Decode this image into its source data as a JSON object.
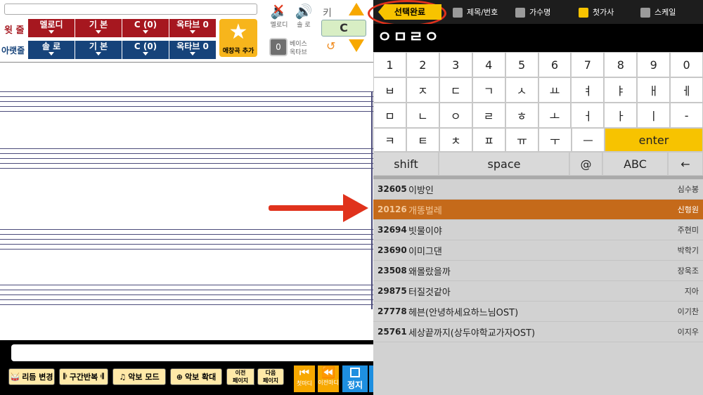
{
  "left": {
    "row1_label": "윗 줄",
    "row2_label": "아랫줄",
    "top_tabs": [
      "멜로디",
      "기 본",
      "C (0)",
      "옥타브 0"
    ],
    "bottom_tabs": [
      "솔 로",
      "기 본",
      "C (0)",
      "옥타브 0"
    ],
    "fav_label": "애창곡 추가",
    "mute_label": "멜로디",
    "solo_label": "솔 로",
    "key_label": "키",
    "key_value": "C",
    "bass_value": "0",
    "bass_label1": "베이스",
    "bass_label2": "옥타브"
  },
  "toolbar": {
    "rhythm": "리듬 변경",
    "section": "구간반복",
    "score_mode": "악보 모드",
    "zoom": "악보 확대",
    "prev_page": [
      "이전",
      "페이지"
    ],
    "next_page": [
      "다음",
      "페이지"
    ],
    "first": "첫마디",
    "prev": "이전마디",
    "stop": "정지"
  },
  "right": {
    "done_button": "선택완료",
    "filters": [
      {
        "label": "제목/번호",
        "checked": false
      },
      {
        "label": "가수명",
        "checked": false
      },
      {
        "label": "첫가사",
        "checked": true
      },
      {
        "label": "스케일",
        "checked": false
      }
    ],
    "search_text": "ㅇㅁㄹㅇ",
    "keyboard": {
      "row1": [
        "1",
        "2",
        "3",
        "4",
        "5",
        "6",
        "7",
        "8",
        "9",
        "0"
      ],
      "row2": [
        "ㅂ",
        "ㅈ",
        "ㄷ",
        "ㄱ",
        "ㅅ",
        "ㅛ",
        "ㅕ",
        "ㅑ",
        "ㅐ",
        "ㅔ"
      ],
      "row3": [
        "ㅁ",
        "ㄴ",
        "ㅇ",
        "ㄹ",
        "ㅎ",
        "ㅗ",
        "ㅓ",
        "ㅏ",
        "ㅣ",
        "-"
      ],
      "row4": [
        "ㅋ",
        "ㅌ",
        "ㅊ",
        "ㅍ",
        "ㅠ",
        "ㅜ",
        "ㅡ"
      ],
      "enter": "enter",
      "row5": [
        "shift",
        "space",
        "@",
        "ABC",
        "←"
      ]
    },
    "songs": [
      {
        "num": "32605",
        "title": "이방인",
        "singer": "심수봉"
      },
      {
        "num": "20126",
        "title": "개똥벌레",
        "singer": "신형원"
      },
      {
        "num": "32694",
        "title": "빗물이야",
        "singer": "주현미"
      },
      {
        "num": "23690",
        "title": "이미그댄",
        "singer": "박학기"
      },
      {
        "num": "23508",
        "title": "왜몰랐을까",
        "singer": "장욱조"
      },
      {
        "num": "29875",
        "title": "터질것같아",
        "singer": "지아"
      },
      {
        "num": "27778",
        "title": "헤븐(안녕하세요하느님OST)",
        "singer": "이기찬"
      },
      {
        "num": "25761",
        "title": "세상끝까지(상두야학교가자OST)",
        "singer": "이지우"
      }
    ],
    "selected_index": 1
  },
  "colors": {
    "accent_red": "#a6171f",
    "accent_blue": "#16437a",
    "highlight": "#c56a1a",
    "yellow": "#f7c300"
  }
}
